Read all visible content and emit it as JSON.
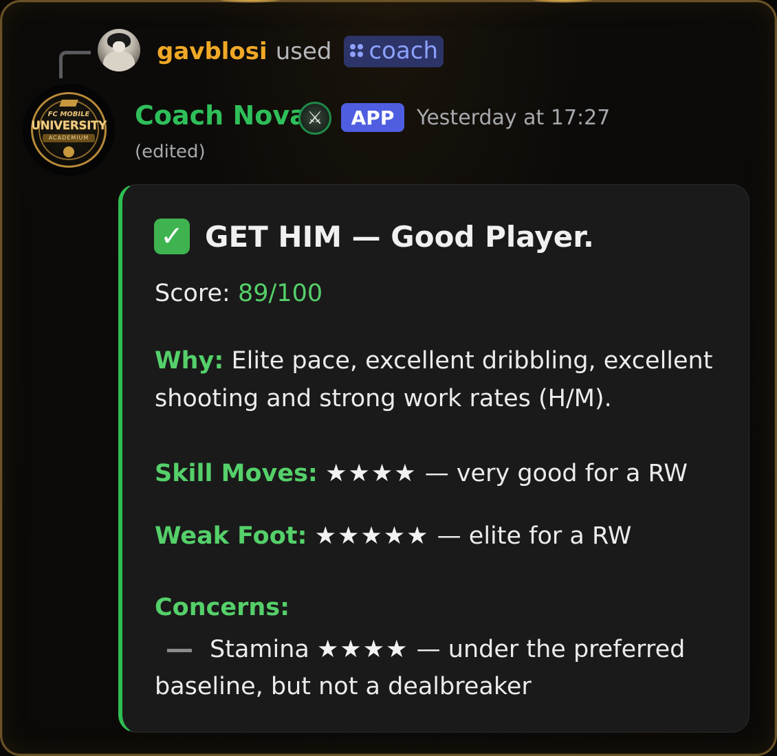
{
  "reply": {
    "username": "gavblosi",
    "used_text": "used",
    "command": "coach"
  },
  "message": {
    "author": "Coach Nova",
    "app_tag": "APP",
    "timestamp": "Yesterday at 17:27",
    "edited": "(edited)",
    "avatar_text": {
      "line1": "FC MOBILE",
      "line2": "UNIVERSITY",
      "line3": "ACADEMIUM"
    }
  },
  "embed": {
    "accent_color": "#2ebe52",
    "title_icon": "check-mark-button",
    "title": "GET HIM — Good Player.",
    "score_label": "Score:",
    "score_value": "89/100",
    "why_label": "Why:",
    "why_line1": "Elite pace, excellent dribbling, excellent",
    "why_line2": "shooting and strong work rates (H/M).",
    "skill_label": "Skill Moves:",
    "skill_stars": "★★★★",
    "skill_rating": 4,
    "skill_note": "— very good for a RW",
    "weak_label": "Weak Foot:",
    "weak_stars": "★★★★★",
    "weak_rating": 5,
    "weak_note": "— elite for a RW",
    "concerns_label": "Concerns:",
    "concern_item": "Stamina",
    "concern_stars": "★★★★",
    "concern_rating": 4,
    "concern_note_line1": "— under the preferred",
    "concern_note_line2": "baseline, but not a dealbreaker"
  }
}
